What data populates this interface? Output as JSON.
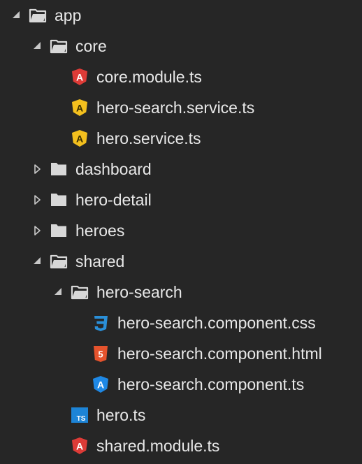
{
  "tree": {
    "items": [
      {
        "name": "app",
        "type": "folder",
        "state": "expanded",
        "depth": 0,
        "icon": "folder-open-icon"
      },
      {
        "name": "core",
        "type": "folder",
        "state": "expanded",
        "depth": 1,
        "icon": "folder-open-icon"
      },
      {
        "name": "core.module.ts",
        "type": "file",
        "depth": 2,
        "icon": "angular-module-icon",
        "icon_color": "#dd3b37"
      },
      {
        "name": "hero-search.service.ts",
        "type": "file",
        "depth": 2,
        "icon": "angular-service-icon",
        "icon_color": "#f4c01e"
      },
      {
        "name": "hero.service.ts",
        "type": "file",
        "depth": 2,
        "icon": "angular-service-icon",
        "icon_color": "#f4c01e"
      },
      {
        "name": "dashboard",
        "type": "folder",
        "state": "collapsed",
        "depth": 1,
        "icon": "folder-closed-icon"
      },
      {
        "name": "hero-detail",
        "type": "folder",
        "state": "collapsed",
        "depth": 1,
        "icon": "folder-closed-icon"
      },
      {
        "name": "heroes",
        "type": "folder",
        "state": "collapsed",
        "depth": 1,
        "icon": "folder-closed-icon"
      },
      {
        "name": "shared",
        "type": "folder",
        "state": "expanded",
        "depth": 1,
        "icon": "folder-open-icon"
      },
      {
        "name": "hero-search",
        "type": "folder",
        "state": "expanded",
        "depth": 2,
        "icon": "folder-open-icon"
      },
      {
        "name": "hero-search.component.css",
        "type": "file",
        "depth": 3,
        "icon": "css3-icon",
        "icon_color": "#2a8fd8"
      },
      {
        "name": "hero-search.component.html",
        "type": "file",
        "depth": 3,
        "icon": "html5-icon",
        "icon_color": "#e5532d"
      },
      {
        "name": "hero-search.component.ts",
        "type": "file",
        "depth": 3,
        "icon": "angular-component-icon",
        "icon_color": "#1e88e5"
      },
      {
        "name": "hero.ts",
        "type": "file",
        "depth": 2,
        "icon": "typescript-icon",
        "icon_color": "#1d84d6",
        "badge": "TS"
      },
      {
        "name": "shared.module.ts",
        "type": "file",
        "depth": 2,
        "icon": "angular-module-icon",
        "icon_color": "#dd3b37"
      }
    ]
  }
}
